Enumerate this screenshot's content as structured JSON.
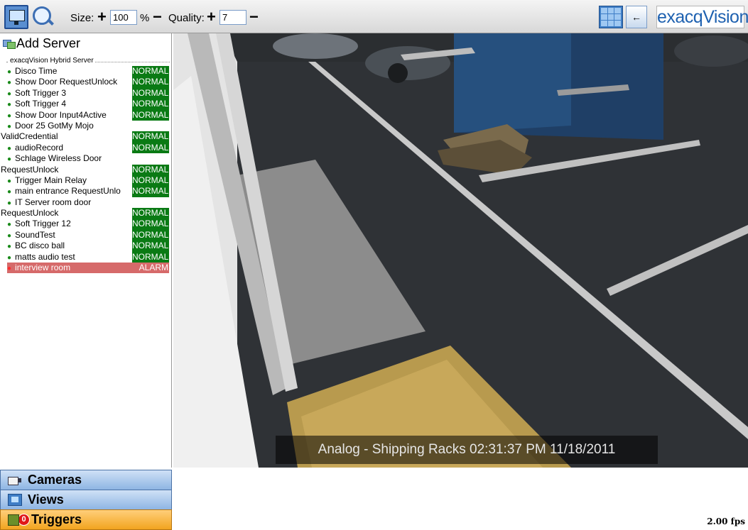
{
  "toolbar": {
    "size_label": "Size:",
    "size_plus": "+",
    "size_value": "100",
    "size_unit": "%",
    "size_minus": "−",
    "quality_label": "Quality:",
    "quality_plus": "+",
    "quality_value": "7",
    "quality_minus": "−",
    "back_arrow": "←",
    "logo_text": "exacqVision"
  },
  "panel": {
    "add_server_label": "Add Server",
    "server_name": "exacqVision Hybrid Server",
    "triggers": [
      {
        "name": "Disco Time",
        "status": "NORMAL",
        "dot": true
      },
      {
        "name": "Show Door RequestUnlock",
        "status": "NORMAL",
        "dot": true
      },
      {
        "name": "Soft Trigger 3",
        "status": "NORMAL",
        "dot": true
      },
      {
        "name": "Soft Trigger 4",
        "status": "NORMAL",
        "dot": true
      },
      {
        "name": "Show Door Input4Active",
        "status": "NORMAL",
        "dot": true
      },
      {
        "name": "Door 25 GotMy Mojo",
        "status": "",
        "dot": true
      },
      {
        "name": "ValidCredential",
        "status": "NORMAL",
        "dot": false
      },
      {
        "name": "audioRecord",
        "status": "NORMAL",
        "dot": true
      },
      {
        "name": "Schlage Wireless Door",
        "status": "",
        "dot": true
      },
      {
        "name": "RequestUnlock",
        "status": "NORMAL",
        "dot": false
      },
      {
        "name": "Trigger Main Relay",
        "status": "NORMAL",
        "dot": true
      },
      {
        "name": "main entrance RequestUnlo",
        "status": "NORMAL",
        "dot": true
      },
      {
        "name": "IT Server room door",
        "status": "",
        "dot": true
      },
      {
        "name": "RequestUnlock",
        "status": "NORMAL",
        "dot": false
      },
      {
        "name": "Soft Trigger 12",
        "status": "NORMAL",
        "dot": true
      },
      {
        "name": "SoundTest",
        "status": "NORMAL",
        "dot": true
      },
      {
        "name": "BC disco ball",
        "status": "NORMAL",
        "dot": true
      },
      {
        "name": "matts audio test",
        "status": "NORMAL",
        "dot": true
      },
      {
        "name": "interview room",
        "status": "ALARM",
        "dot": true
      }
    ],
    "status_colors": {
      "NORMAL": "#0a7a14",
      "ALARM": "#d66a6a"
    }
  },
  "video": {
    "overlay": "Analog - Shipping Racks 02:31:37 PM 11/18/2011"
  },
  "nav": {
    "cameras": "Cameras",
    "views": "Views",
    "triggers": "Triggers",
    "trigger_badge": "0"
  },
  "fps": "2.00 fps"
}
